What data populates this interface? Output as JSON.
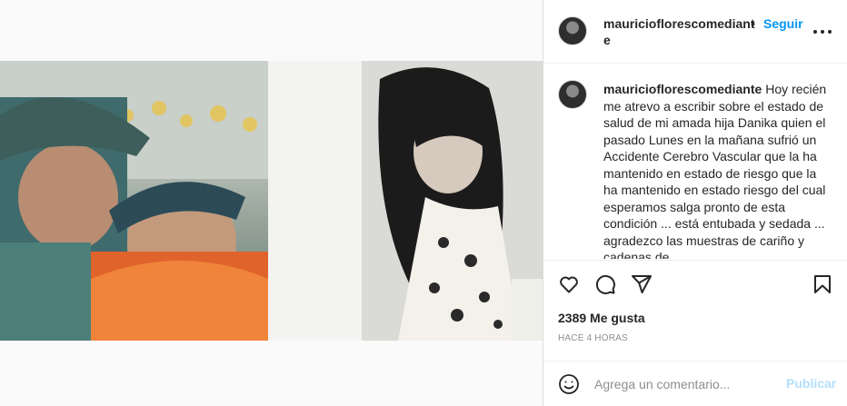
{
  "header": {
    "username": "mauriciofloresc​omediante",
    "separator": "•",
    "follow_label": "Seguir",
    "more_icon": "more-horizontal-icon"
  },
  "caption": {
    "username": "mauriciofloresc​omediante",
    "text": "Hoy recién me atrevo a escribir sobre el estado de salud de mi amada hija Danika quien el pasado Lunes en la mañana sufrió un Accidente Cerebro Vascular que la ha mantenido en estado de riesgo que la ha mantenido en estado riesgo del cual esperamos salga pronto de esta condición ... está entubada y sedada ... agradezco las muestras de cariño y cadenas de"
  },
  "actions": {
    "icons": [
      "heart-icon",
      "comment-icon",
      "share-icon",
      "bookmark-icon"
    ]
  },
  "likes": "2389 Me gusta",
  "timestamp": "HACE 4 HORAS",
  "comment": {
    "placeholder": "Agrega un comentario...",
    "publish_label": "Publicar",
    "emoji_icon": "emoji-icon"
  },
  "colors": {
    "accent": "#0095f6",
    "publish_disabled": "#b2dffc",
    "text": "#262626",
    "muted": "#8e8e8e",
    "border": "#dbdbdb"
  }
}
